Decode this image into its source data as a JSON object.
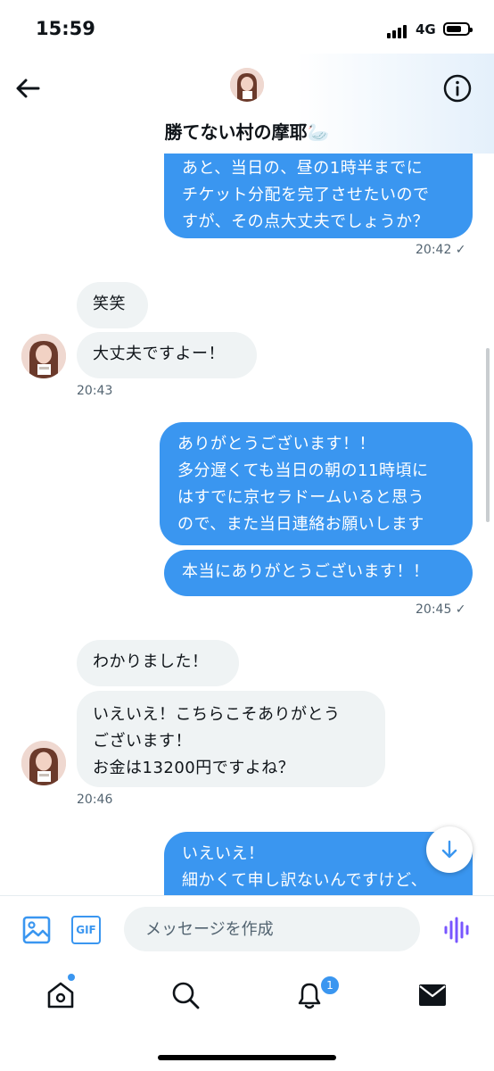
{
  "status_bar": {
    "time": "15:59",
    "network": "4G"
  },
  "header": {
    "title": "勝てない村の摩耶🦢"
  },
  "messages": [
    {
      "text": "あと、当日の、昼の1時半までに\nチケット分配を完了させたいので\nすが、その点大丈夫でしょうか？"
    },
    {
      "text": "笑笑"
    },
    {
      "text": "大丈夫ですよー！"
    },
    {
      "text": "ありがとうございます！！\n多分遅くても当日の朝の11時頃に\nはすでに京セラドームいると思う\nので、また当日連絡お願いします"
    },
    {
      "text": "本当にありがとうございます！！"
    },
    {
      "text": "わかりました！"
    },
    {
      "text": "いえいえ！こちらこそありがとう\nございます！\nお金は13200円ですよね？"
    },
    {
      "text": "いえいえ！\n細かくて申し訳ないんですけど、"
    }
  ],
  "timestamps": {
    "t1": "20:42 ✓",
    "t2": "20:43",
    "t3": "20:45 ✓",
    "t4": "20:46"
  },
  "composer": {
    "placeholder": "メッセージを作成",
    "gif_label": "GIF"
  },
  "tabbar": {
    "notification_count": "1"
  },
  "icons": {
    "back": "arrow-left-icon",
    "info": "info-icon",
    "media": "image-icon",
    "voice": "waveform-icon",
    "scroll": "arrow-down-icon",
    "home": "home-icon",
    "search": "search-icon",
    "notifications": "bell-icon",
    "messages": "mail-icon"
  },
  "colors": {
    "accent": "#3a96f0",
    "incoming_bubble": "#eff3f4",
    "voice_accent": "#7856ff"
  }
}
